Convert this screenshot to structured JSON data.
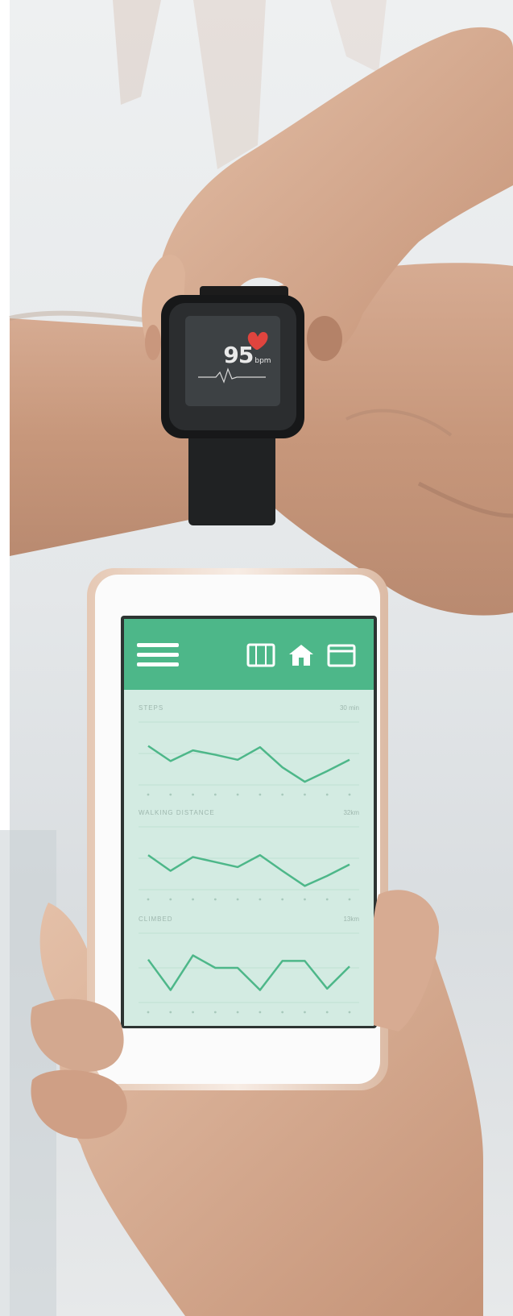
{
  "scene": {
    "description_free": true
  },
  "watch": {
    "bpm_value": "95",
    "bpm_unit": "bpm",
    "heart_icon": "heart-icon"
  },
  "app": {
    "accent": "#4db789",
    "header_icons": [
      "menu-icon",
      "calendar-list-icon",
      "home-icon",
      "calendar-icon"
    ],
    "charts": [
      {
        "title": "STEPS",
        "meta": "30 min",
        "values": [
          0.62,
          0.38,
          0.55,
          0.48,
          0.4,
          0.6,
          0.28,
          0.05,
          0.22,
          0.4
        ]
      },
      {
        "title": "WALKING DISTANCE",
        "meta": "32km",
        "values": [
          0.55,
          0.3,
          0.52,
          0.44,
          0.36,
          0.55,
          0.3,
          0.06,
          0.22,
          0.4
        ]
      },
      {
        "title": "CLIMBED",
        "meta": "13km",
        "values": [
          0.62,
          0.18,
          0.68,
          0.5,
          0.5,
          0.18,
          0.6,
          0.6,
          0.2,
          0.52
        ]
      }
    ]
  }
}
